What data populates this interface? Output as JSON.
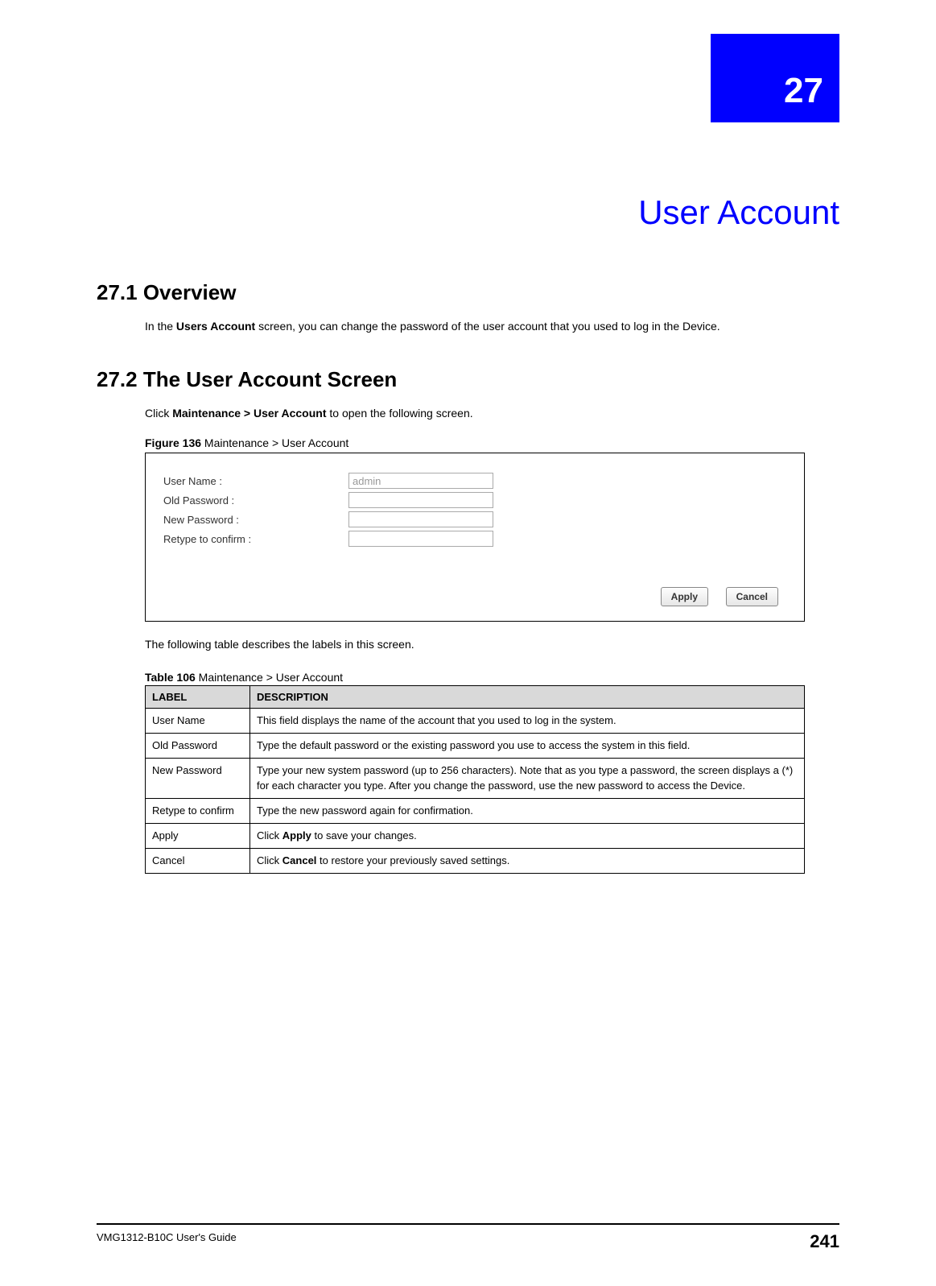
{
  "chapter": {
    "number": "27",
    "title": "User Account"
  },
  "section1": {
    "heading": "27.1  Overview",
    "para_pre": "In the ",
    "para_bold": "Users Account",
    "para_post": " screen, you can change the password of the user account that you used to log in the Device."
  },
  "section2": {
    "heading": "27.2  The User Account Screen",
    "para_pre": "Click ",
    "para_bold": "Maintenance >  User Account",
    "para_post": " to open the following screen.",
    "fig_label": "Figure 136",
    "fig_caption": "   Maintenance > User Account",
    "after_fig": "The following table describes the labels in this screen.",
    "tbl_label": "Table 106",
    "tbl_caption": "   Maintenance > User Account"
  },
  "form": {
    "rows": [
      {
        "label": "User Name :",
        "value": "admin",
        "readonly": true
      },
      {
        "label": "Old Password :",
        "value": "",
        "readonly": false
      },
      {
        "label": "New Password :",
        "value": "",
        "readonly": false
      },
      {
        "label": "Retype to confirm :",
        "value": "",
        "readonly": false
      }
    ],
    "apply": "Apply",
    "cancel": "Cancel"
  },
  "table": {
    "head_label": "LABEL",
    "head_desc": "DESCRIPTION",
    "rows": [
      {
        "label": "User Name",
        "desc": "This field displays the name of the account that you used to log in the system."
      },
      {
        "label": "Old Password",
        "desc": "Type the default password or the existing password you use to access the system in this field."
      },
      {
        "label": "New Password",
        "desc": "Type your new system password (up to 256 characters). Note that as you type a password, the screen displays a (*) for each character you type. After you change the password, use the new password to access the Device."
      },
      {
        "label": "Retype to confirm",
        "desc": "Type the new password again for confirmation."
      },
      {
        "label": "Apply",
        "desc_pre": "Click ",
        "desc_bold": "Apply",
        "desc_post": " to save your changes."
      },
      {
        "label": "Cancel",
        "desc_pre": "Click ",
        "desc_bold": "Cancel",
        "desc_post": " to restore your previously saved settings."
      }
    ]
  },
  "footer": {
    "guide": "VMG1312-B10C User's Guide",
    "page": "241"
  }
}
